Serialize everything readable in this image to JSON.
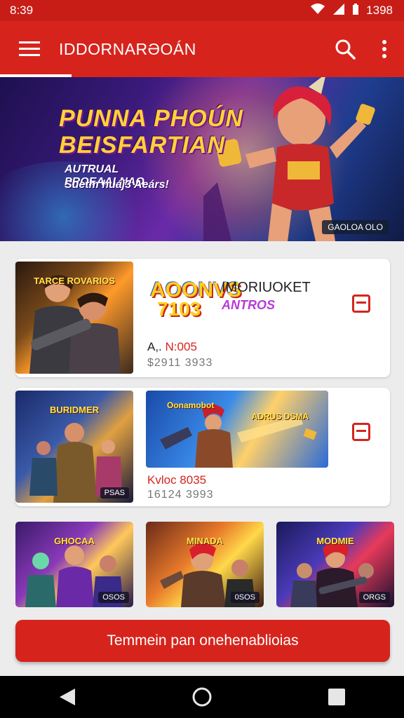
{
  "status_bar": {
    "time": "8:39",
    "battery": "1398"
  },
  "app_bar": {
    "title": "IDDORNARƏOÁN"
  },
  "hero": {
    "title_line1": "PUNNA PHOÚN",
    "title_line2": "BEISFARTIAN",
    "subtitle_line1": "AUTRUAL PROEAALNAO",
    "subtitle_line2": "Suetm huáj3 Aeárs!",
    "badge": "GAOLOA OLO"
  },
  "cards": [
    {
      "thumb_label": "TARCE ROVARIOS",
      "thumb_badge": "",
      "logo_line1": "AOONVS",
      "logo_line2": "7103",
      "title": "IMORIUOKET",
      "subtitle": "ANTROS",
      "price_prefix": "A,.",
      "price_value": "N:005",
      "meta": "$2911 3933"
    },
    {
      "thumb_label": "BURIDMER",
      "thumb_badge": "PSAS",
      "image_label_1": "Oonamobot",
      "image_label_2": "ADRUS DSMA",
      "price": "Kvloc 8035",
      "meta": "16124 3993"
    }
  ],
  "thumb_row": [
    {
      "label": "GHOCAA",
      "badge": "OSOS"
    },
    {
      "label": "MINADA",
      "badge": "0SOS"
    },
    {
      "label": "MODMIE",
      "badge": "ORGS"
    }
  ],
  "cta": {
    "label": "Temmein pan onehenablioias"
  },
  "colors": {
    "primary": "#d6241d",
    "status_bar": "#c81d17",
    "background": "#ececec"
  }
}
